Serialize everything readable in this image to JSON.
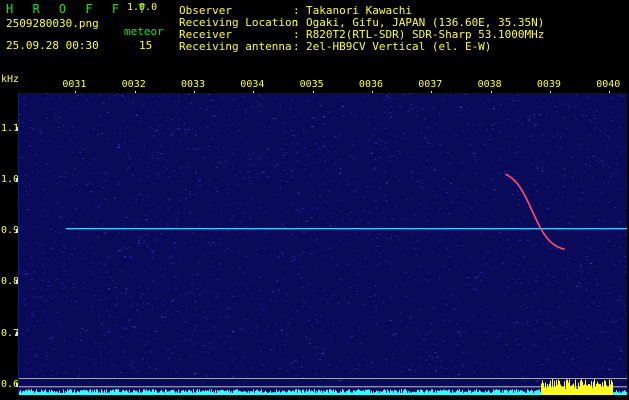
{
  "app": {
    "name": "H R O F F T",
    "version": "1.0.0"
  },
  "file": {
    "name": "2509280030.png",
    "datetime": "25.09.28 00:30",
    "meteor_label": "meteor",
    "meteor_count": "15"
  },
  "info": {
    "rows": [
      {
        "label": "Observer",
        "sep": ":",
        "value": "Takanori Kawachi"
      },
      {
        "label": "Receiving Location",
        "sep": ":",
        "value": "Ogaki, Gifu, JAPAN (136.60E, 35.35N)"
      },
      {
        "label": "Receiver",
        "sep": ":",
        "value": "R820T2(RTL-SDR) SDR-Sharp 53.1000MHz"
      },
      {
        "label": "Receiving antenna",
        "sep": ":",
        "value": "2el-HB9CV Vertical (el. E-W)"
      }
    ]
  },
  "spectrogram": {
    "y_unit": "kHz",
    "y_ticks": [
      "1.1",
      "1.0",
      "0.9",
      "0.8",
      "0.7",
      "0.6"
    ],
    "y_tick_values": [
      1.1,
      1.0,
      0.9,
      0.8,
      0.7,
      0.6
    ],
    "y_range": [
      0.58,
      1.17
    ],
    "x_ticks": [
      "0031",
      "0032",
      "0033",
      "0034",
      "0035",
      "0036",
      "0037",
      "0038",
      "0039",
      "0040"
    ],
    "x_tick_values": [
      31,
      32,
      33,
      34,
      35,
      36,
      37,
      38,
      39,
      40
    ],
    "x_range": [
      30.05,
      40.3
    ],
    "carrier_khz": 0.905,
    "colors": {
      "background": "#0a0a5a",
      "noise": "#2e2ea8",
      "carrier": "#40c8ff",
      "meteor_echo": "#ff5070",
      "axis_text": "#ffff30",
      "title_text": "#19e019",
      "baseline": "#30ffff",
      "baseline_burst": "#ffff20"
    }
  }
}
